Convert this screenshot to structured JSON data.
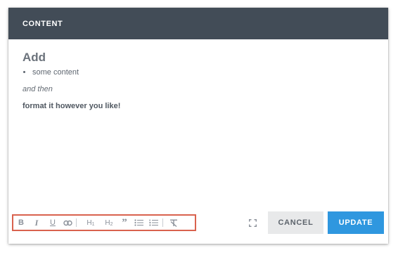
{
  "dialog": {
    "title": "CONTENT"
  },
  "content": {
    "heading": "Add",
    "list_items": [
      "some content"
    ],
    "italic_text": "and then",
    "bold_text": "format it however you like!"
  },
  "toolbar": {
    "bold_label": "B",
    "italic_label": "I",
    "underline_label": "U",
    "h1_label": "H",
    "h1_sub": "1",
    "h2_label": "H",
    "h2_sub": "2",
    "quote_label": "”",
    "highlight_color": "#d9624e",
    "icons": [
      "bold-icon",
      "italic-icon",
      "underline-icon",
      "link-icon",
      "heading1-icon",
      "heading2-icon",
      "blockquote-icon",
      "bullet-list-icon",
      "numbered-list-icon",
      "clear-format-icon"
    ]
  },
  "footer": {
    "cancel_label": "CANCEL",
    "update_label": "UPDATE",
    "fullscreen_icon": "fullscreen-icon"
  },
  "colors": {
    "header_bg": "#424c57",
    "primary": "#2f97df",
    "cancel_bg": "#e8e9ea"
  }
}
